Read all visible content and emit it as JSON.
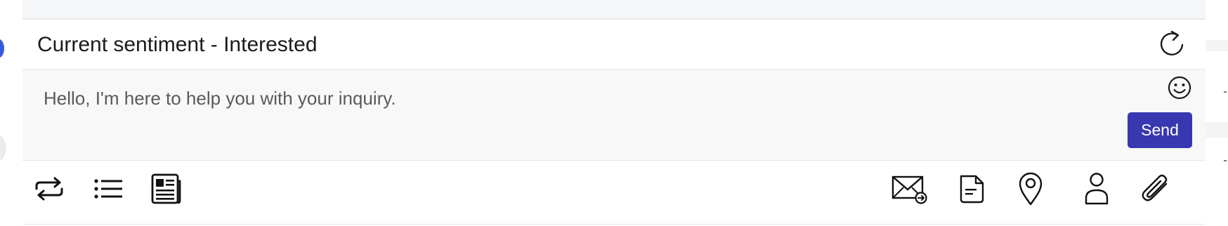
{
  "sentiment": {
    "text": "Current sentiment - Interested"
  },
  "compose": {
    "placeholder": "Hello, I'm here to help you with your inquiry.",
    "send_label": "Send",
    "send_color": "#3838b0"
  },
  "icons": {
    "refresh": "refresh-icon",
    "emoji": "emoji-icon",
    "left_tools": [
      "transfer-icon",
      "list-icon",
      "newspaper-icon"
    ],
    "right_tools": [
      "email-forward-icon",
      "document-icon",
      "location-pin-icon",
      "contact-icon",
      "paperclip-icon"
    ]
  }
}
